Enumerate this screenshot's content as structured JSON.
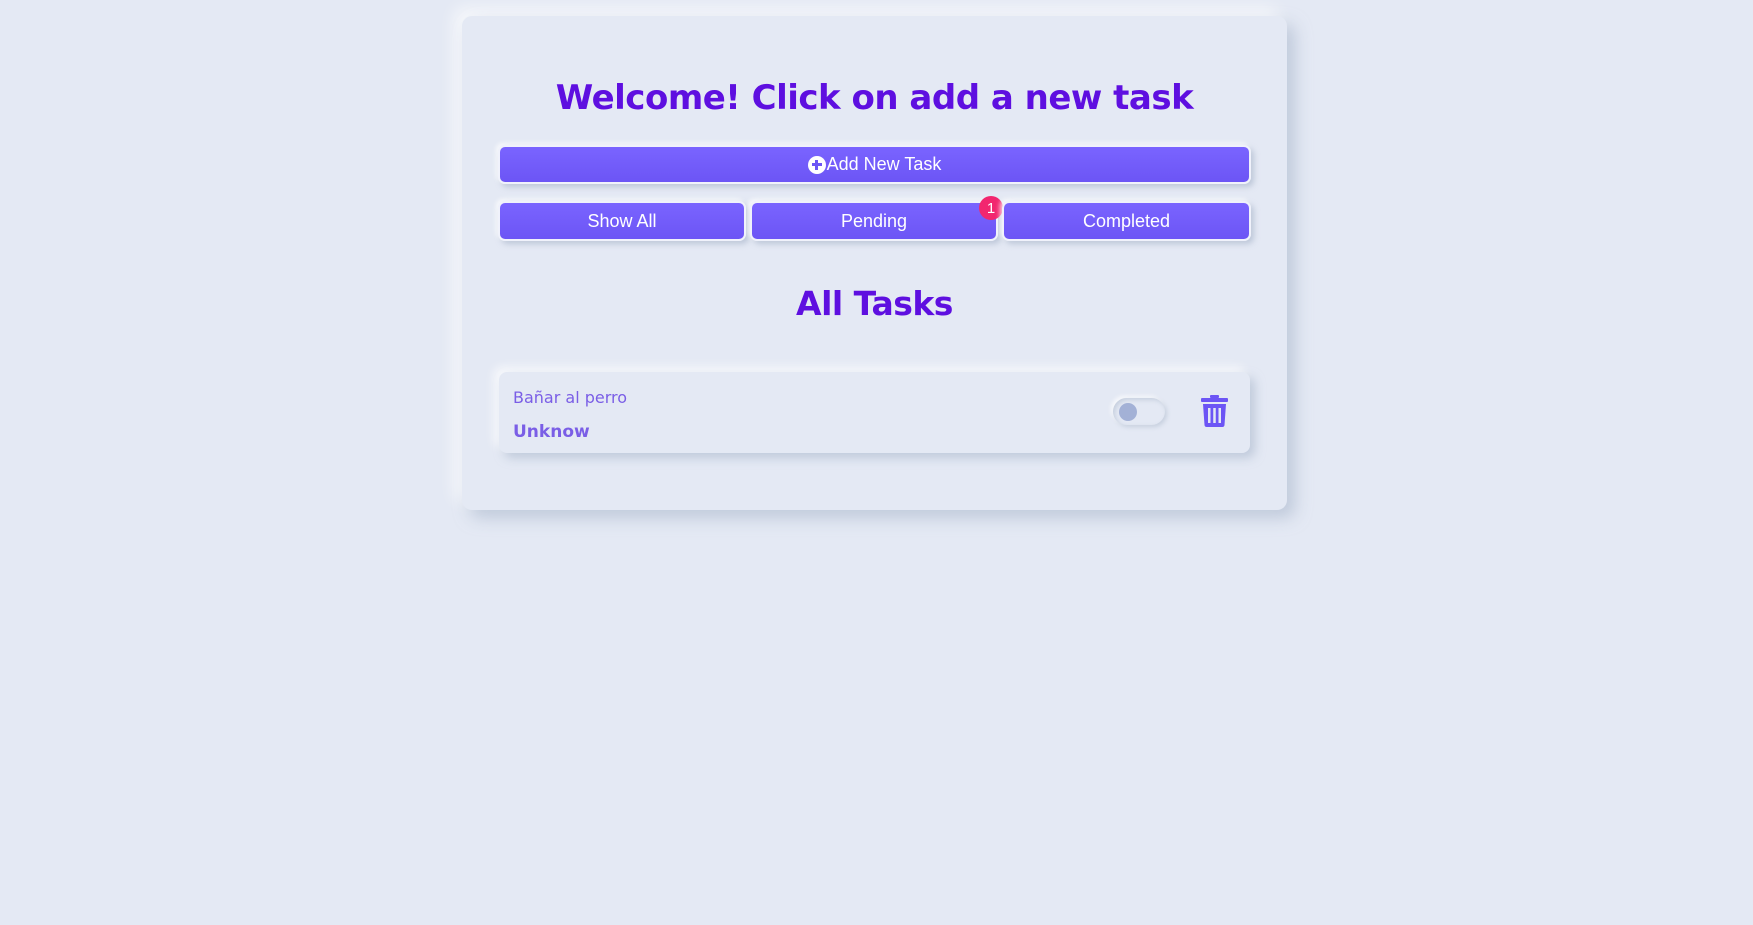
{
  "header": {
    "title": "Welcome! Click on add a new task"
  },
  "actions": {
    "add_label": "Add New Task"
  },
  "filters": {
    "show_all": "Show All",
    "pending": "Pending",
    "completed": "Completed",
    "pending_count": "1"
  },
  "list": {
    "title": "All Tasks",
    "tasks": [
      {
        "title": "Bañar al perro",
        "status": "Unknow",
        "completed": false
      }
    ]
  },
  "colors": {
    "accent": "#6c55f5",
    "heading": "#5e0fe0",
    "badge": "#f2266f",
    "background": "#e4e9f4"
  },
  "icons": {
    "add": "plus-circle-icon",
    "delete": "trash-icon"
  }
}
